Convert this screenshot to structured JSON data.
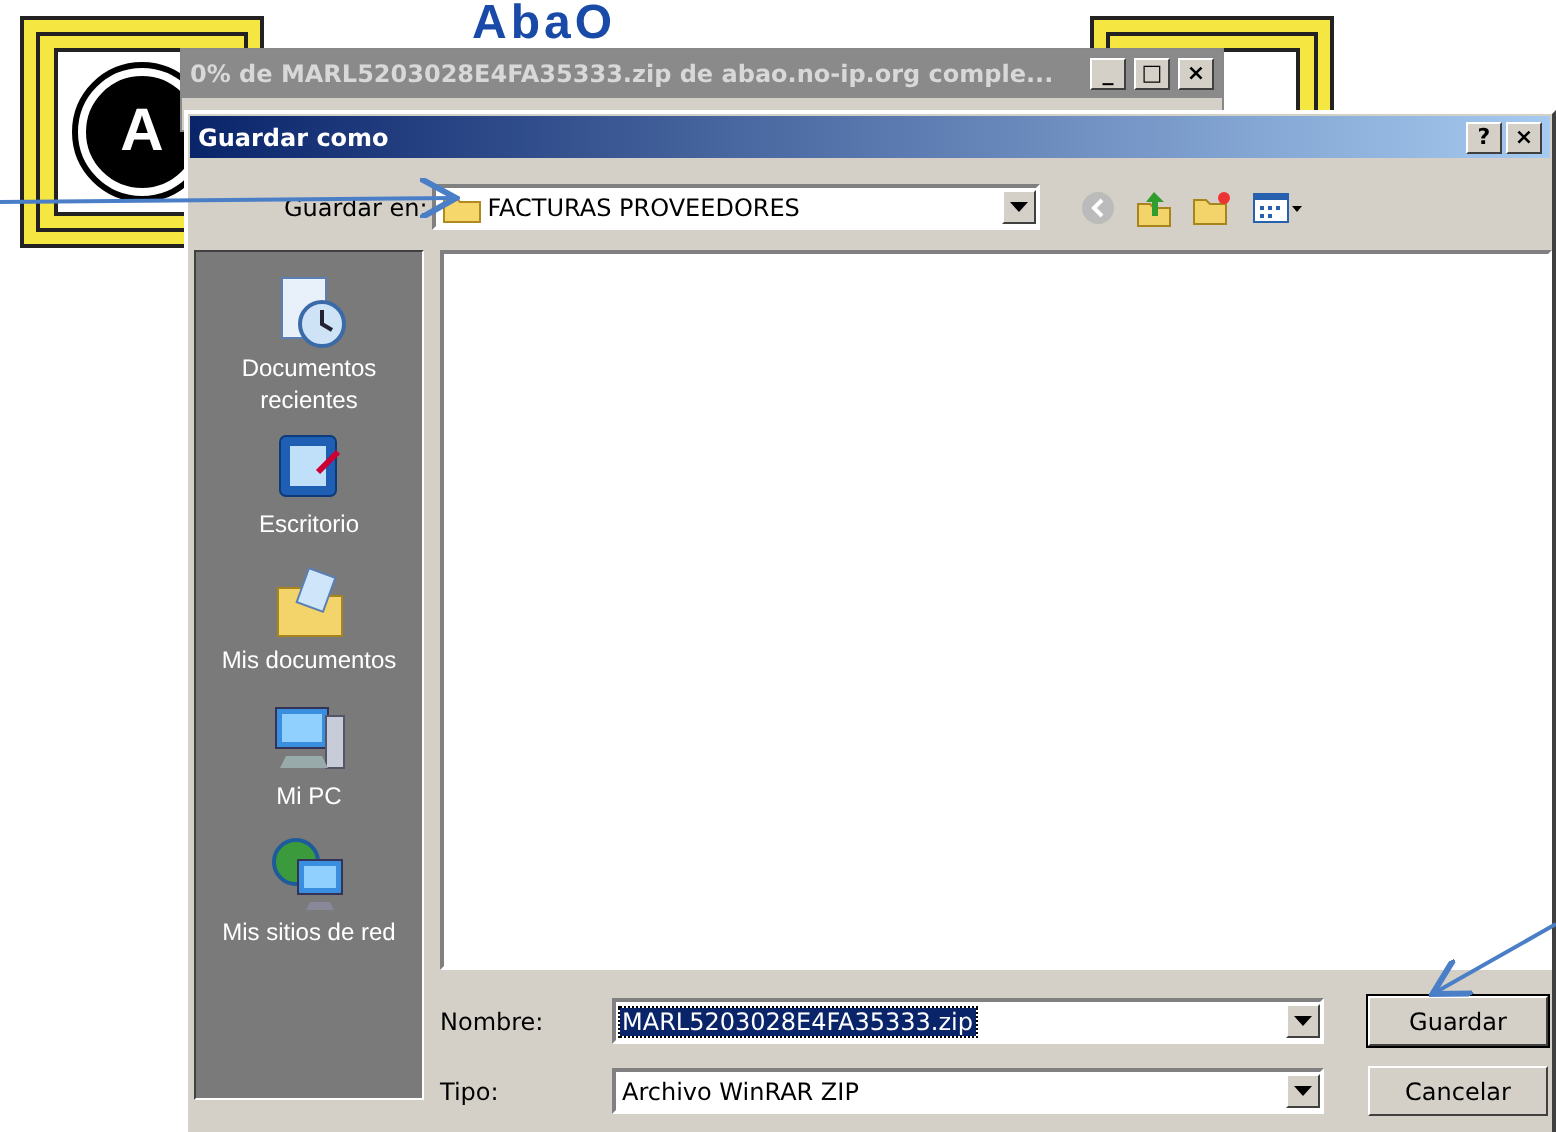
{
  "background_page": {
    "logo_text": "AbaO",
    "badge_letter": "A"
  },
  "download_window": {
    "title": "0% de MARL5203028E4FA35333.zip de abao.no-ip.org comple...",
    "controls": [
      "_",
      "□",
      "×"
    ]
  },
  "dialog": {
    "title": "Guardar como",
    "title_buttons": [
      "?",
      "×"
    ],
    "save_in": {
      "label": "Guardar en:",
      "value": "FACTURAS PROVEEDORES"
    },
    "places": [
      {
        "kind": "recent",
        "label": "Documentos recientes"
      },
      {
        "kind": "desktop",
        "label": "Escritorio"
      },
      {
        "kind": "documents",
        "label": "Mis documentos"
      },
      {
        "kind": "computer",
        "label": "Mi PC"
      },
      {
        "kind": "network",
        "label": "Mis sitios de red"
      }
    ],
    "fields": [
      {
        "label": "Nombre:",
        "value": "MARL5203028E4FA35333.zip",
        "selected": true
      },
      {
        "label": "Tipo:",
        "value": "Archivo WinRAR ZIP",
        "selected": false
      }
    ],
    "buttons": [
      "Guardar",
      "Cancelar"
    ]
  }
}
